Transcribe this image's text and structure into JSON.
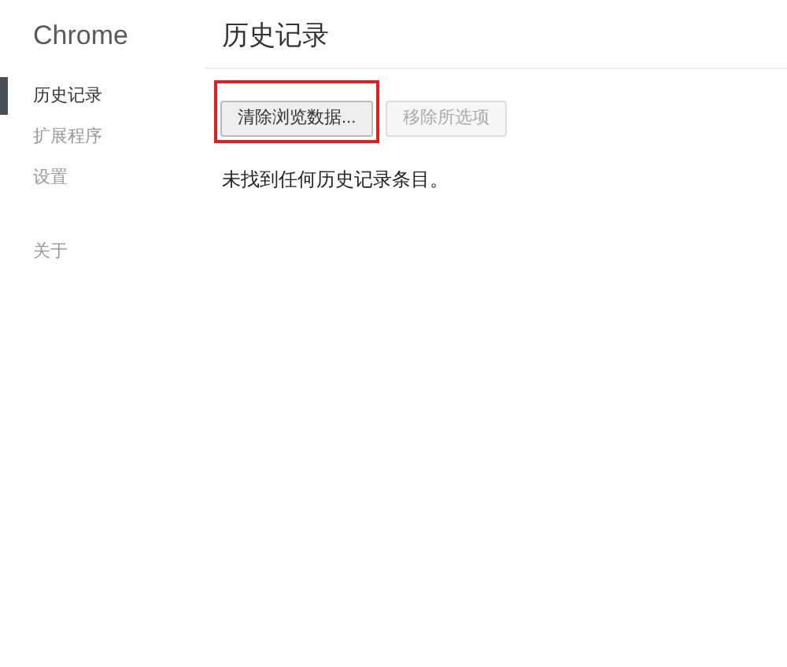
{
  "sidebar": {
    "brand": "Chrome",
    "items": [
      {
        "label": "历史记录",
        "selected": true
      },
      {
        "label": "扩展程序",
        "selected": false
      },
      {
        "label": "设置",
        "selected": false
      }
    ],
    "about": "关于"
  },
  "page": {
    "title": "历史记录",
    "buttons": [
      {
        "label": "清除浏览数据...",
        "disabled": false,
        "annotated": true
      },
      {
        "label": "移除所选项",
        "disabled": true,
        "annotated": false
      }
    ],
    "message": "未找到任何历史记录条目。"
  }
}
